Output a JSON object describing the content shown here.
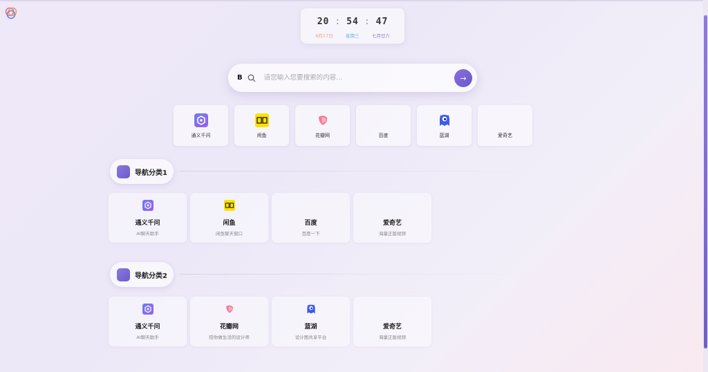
{
  "clock": {
    "hour": "20",
    "minute": "54",
    "second": "47",
    "date": "9月17日",
    "weekday": "星期三",
    "lunar": "七月廿六"
  },
  "search": {
    "engine": "B",
    "placeholder": "请您输入您要搜索的内容..."
  },
  "quick_links": [
    {
      "label": "通义千问",
      "icon": "tongyi-icon"
    },
    {
      "label": "闲鱼",
      "icon": "xianyu-icon"
    },
    {
      "label": "花瓣网",
      "icon": "huaban-icon"
    },
    {
      "label": "百度",
      "icon": ""
    },
    {
      "label": "蓝湖",
      "icon": "lanhu-icon"
    },
    {
      "label": "爱奇艺",
      "icon": ""
    }
  ],
  "sections": [
    {
      "title": "导航分类1",
      "items": [
        {
          "title": "通义千问",
          "desc": "AI聊天助手",
          "icon": "tongyi-icon"
        },
        {
          "title": "闲鱼",
          "desc": "闲鱼聊天窗口",
          "icon": "xianyu-icon"
        },
        {
          "title": "百度",
          "desc": "百度一下",
          "icon": ""
        },
        {
          "title": "爱奇艺",
          "desc": "海量正版视频",
          "icon": ""
        }
      ]
    },
    {
      "title": "导航分类2",
      "items": [
        {
          "title": "通义千问",
          "desc": "AI聊天助手",
          "icon": "tongyi-icon"
        },
        {
          "title": "花瓣网",
          "desc": "陪你做生活的设计师",
          "icon": "huaban-icon"
        },
        {
          "title": "蓝湖",
          "desc": "设计图共享平台",
          "icon": "lanhu-icon"
        },
        {
          "title": "爱奇艺",
          "desc": "海量正版视频",
          "icon": ""
        }
      ]
    }
  ],
  "colors": {
    "accent": "#7464d4",
    "xianyu": "#ffe100",
    "huaban": "#f35a7a",
    "lanhu": "#3b5be8"
  }
}
